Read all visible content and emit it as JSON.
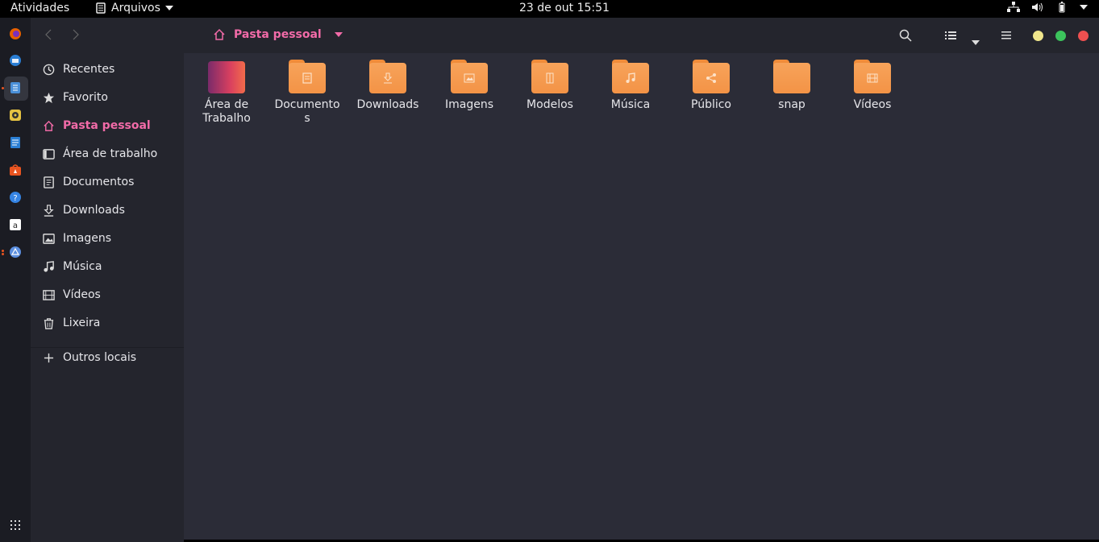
{
  "topbar": {
    "activities": "Atividades",
    "app_name": "Arquivos",
    "clock": "23 de out  15:51"
  },
  "header": {
    "location": "Pasta pessoal"
  },
  "sidebar": {
    "items": [
      {
        "label": "Recentes",
        "icon": "clock-icon"
      },
      {
        "label": "Favorito",
        "icon": "star-icon"
      },
      {
        "label": "Pasta pessoal",
        "icon": "home-icon",
        "active": true
      },
      {
        "label": "Área de trabalho",
        "icon": "desktop-icon"
      },
      {
        "label": "Documentos",
        "icon": "document-icon"
      },
      {
        "label": "Downloads",
        "icon": "download-icon"
      },
      {
        "label": "Imagens",
        "icon": "image-icon"
      },
      {
        "label": "Música",
        "icon": "music-icon"
      },
      {
        "label": "Vídeos",
        "icon": "video-icon"
      },
      {
        "label": "Lixeira",
        "icon": "trash-icon"
      }
    ],
    "other_locations": "Outros locais"
  },
  "folders": [
    {
      "label": "Área de Trabalho",
      "label_lines": [
        "Área de",
        "Trabalho"
      ],
      "icon": "desktop-folder-icon"
    },
    {
      "label": "Documentos",
      "label_lines": [
        "Documento",
        "s"
      ],
      "icon": "document-folder-icon"
    },
    {
      "label": "Downloads",
      "label_lines": [
        "Downloads"
      ],
      "icon": "download-folder-icon"
    },
    {
      "label": "Imagens",
      "label_lines": [
        "Imagens"
      ],
      "icon": "image-folder-icon"
    },
    {
      "label": "Modelos",
      "label_lines": [
        "Modelos"
      ],
      "icon": "templates-folder-icon"
    },
    {
      "label": "Música",
      "label_lines": [
        "Música"
      ],
      "icon": "music-folder-icon"
    },
    {
      "label": "Público",
      "label_lines": [
        "Público"
      ],
      "icon": "share-folder-icon"
    },
    {
      "label": "snap",
      "label_lines": [
        "snap"
      ],
      "icon": "folder-icon"
    },
    {
      "label": "Vídeos",
      "label_lines": [
        "Vídeos"
      ],
      "icon": "video-folder-icon"
    }
  ],
  "colors": {
    "accent": "#f26ba8",
    "folder": "#f39346",
    "sidebar_bg": "#24252d",
    "main_bg": "#2b2c37",
    "minimize": "#f0e68c",
    "maximize": "#3cc35c",
    "close": "#f05050"
  }
}
